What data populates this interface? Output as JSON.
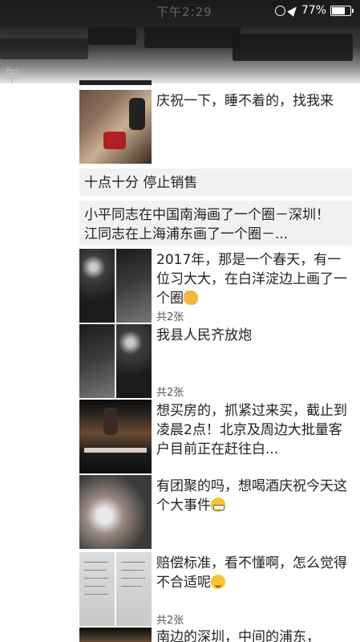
{
  "status_bar": {
    "time": "下午2:29",
    "battery": "77%",
    "lock_icon": "rotation-lock-icon",
    "location_icon": "location-arrow-icon"
  },
  "header": {
    "label": "年"
  },
  "posts": [
    {
      "text": "庆祝一下，睡不着的，找我来",
      "thumb": "bar-interior"
    },
    {
      "text": "十点十分 停止销售"
    },
    {
      "text": "小平同志在中国南海画了一个圈－深圳！ 江同志在上海浦东画了一个圈－..."
    },
    {
      "text": "2017年，那是一个春天，有一位习大大，在白洋淀边上画了一个圈",
      "count": "共2张"
    },
    {
      "text": "我县人民齐放炮",
      "count": "共2张"
    },
    {
      "text": "想买房的，抓紧过来买，截止到凌晨2点！北京及周边大批量客户目前正在赶往白..."
    },
    {
      "text": "有团聚的吗，想喝酒庆祝今天这个大事件"
    },
    {
      "text": "赔偿标准，看不懂啊，怎么觉得不合适呢",
      "count": "共2张"
    },
    {
      "text": "南边的深圳，中间的浦东，"
    }
  ]
}
